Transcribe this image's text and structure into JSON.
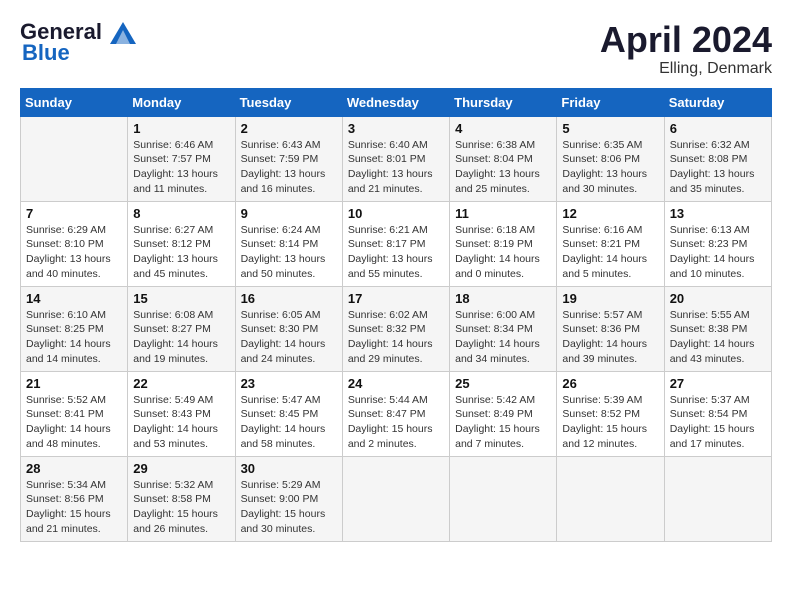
{
  "header": {
    "logo_line1": "General",
    "logo_line2": "Blue",
    "month_title": "April 2024",
    "location": "Elling, Denmark"
  },
  "days_of_week": [
    "Sunday",
    "Monday",
    "Tuesday",
    "Wednesday",
    "Thursday",
    "Friday",
    "Saturday"
  ],
  "weeks": [
    [
      {
        "num": "",
        "sunrise": "",
        "sunset": "",
        "daylight": ""
      },
      {
        "num": "1",
        "sunrise": "Sunrise: 6:46 AM",
        "sunset": "Sunset: 7:57 PM",
        "daylight": "Daylight: 13 hours and 11 minutes."
      },
      {
        "num": "2",
        "sunrise": "Sunrise: 6:43 AM",
        "sunset": "Sunset: 7:59 PM",
        "daylight": "Daylight: 13 hours and 16 minutes."
      },
      {
        "num": "3",
        "sunrise": "Sunrise: 6:40 AM",
        "sunset": "Sunset: 8:01 PM",
        "daylight": "Daylight: 13 hours and 21 minutes."
      },
      {
        "num": "4",
        "sunrise": "Sunrise: 6:38 AM",
        "sunset": "Sunset: 8:04 PM",
        "daylight": "Daylight: 13 hours and 25 minutes."
      },
      {
        "num": "5",
        "sunrise": "Sunrise: 6:35 AM",
        "sunset": "Sunset: 8:06 PM",
        "daylight": "Daylight: 13 hours and 30 minutes."
      },
      {
        "num": "6",
        "sunrise": "Sunrise: 6:32 AM",
        "sunset": "Sunset: 8:08 PM",
        "daylight": "Daylight: 13 hours and 35 minutes."
      }
    ],
    [
      {
        "num": "7",
        "sunrise": "Sunrise: 6:29 AM",
        "sunset": "Sunset: 8:10 PM",
        "daylight": "Daylight: 13 hours and 40 minutes."
      },
      {
        "num": "8",
        "sunrise": "Sunrise: 6:27 AM",
        "sunset": "Sunset: 8:12 PM",
        "daylight": "Daylight: 13 hours and 45 minutes."
      },
      {
        "num": "9",
        "sunrise": "Sunrise: 6:24 AM",
        "sunset": "Sunset: 8:14 PM",
        "daylight": "Daylight: 13 hours and 50 minutes."
      },
      {
        "num": "10",
        "sunrise": "Sunrise: 6:21 AM",
        "sunset": "Sunset: 8:17 PM",
        "daylight": "Daylight: 13 hours and 55 minutes."
      },
      {
        "num": "11",
        "sunrise": "Sunrise: 6:18 AM",
        "sunset": "Sunset: 8:19 PM",
        "daylight": "Daylight: 14 hours and 0 minutes."
      },
      {
        "num": "12",
        "sunrise": "Sunrise: 6:16 AM",
        "sunset": "Sunset: 8:21 PM",
        "daylight": "Daylight: 14 hours and 5 minutes."
      },
      {
        "num": "13",
        "sunrise": "Sunrise: 6:13 AM",
        "sunset": "Sunset: 8:23 PM",
        "daylight": "Daylight: 14 hours and 10 minutes."
      }
    ],
    [
      {
        "num": "14",
        "sunrise": "Sunrise: 6:10 AM",
        "sunset": "Sunset: 8:25 PM",
        "daylight": "Daylight: 14 hours and 14 minutes."
      },
      {
        "num": "15",
        "sunrise": "Sunrise: 6:08 AM",
        "sunset": "Sunset: 8:27 PM",
        "daylight": "Daylight: 14 hours and 19 minutes."
      },
      {
        "num": "16",
        "sunrise": "Sunrise: 6:05 AM",
        "sunset": "Sunset: 8:30 PM",
        "daylight": "Daylight: 14 hours and 24 minutes."
      },
      {
        "num": "17",
        "sunrise": "Sunrise: 6:02 AM",
        "sunset": "Sunset: 8:32 PM",
        "daylight": "Daylight: 14 hours and 29 minutes."
      },
      {
        "num": "18",
        "sunrise": "Sunrise: 6:00 AM",
        "sunset": "Sunset: 8:34 PM",
        "daylight": "Daylight: 14 hours and 34 minutes."
      },
      {
        "num": "19",
        "sunrise": "Sunrise: 5:57 AM",
        "sunset": "Sunset: 8:36 PM",
        "daylight": "Daylight: 14 hours and 39 minutes."
      },
      {
        "num": "20",
        "sunrise": "Sunrise: 5:55 AM",
        "sunset": "Sunset: 8:38 PM",
        "daylight": "Daylight: 14 hours and 43 minutes."
      }
    ],
    [
      {
        "num": "21",
        "sunrise": "Sunrise: 5:52 AM",
        "sunset": "Sunset: 8:41 PM",
        "daylight": "Daylight: 14 hours and 48 minutes."
      },
      {
        "num": "22",
        "sunrise": "Sunrise: 5:49 AM",
        "sunset": "Sunset: 8:43 PM",
        "daylight": "Daylight: 14 hours and 53 minutes."
      },
      {
        "num": "23",
        "sunrise": "Sunrise: 5:47 AM",
        "sunset": "Sunset: 8:45 PM",
        "daylight": "Daylight: 14 hours and 58 minutes."
      },
      {
        "num": "24",
        "sunrise": "Sunrise: 5:44 AM",
        "sunset": "Sunset: 8:47 PM",
        "daylight": "Daylight: 15 hours and 2 minutes."
      },
      {
        "num": "25",
        "sunrise": "Sunrise: 5:42 AM",
        "sunset": "Sunset: 8:49 PM",
        "daylight": "Daylight: 15 hours and 7 minutes."
      },
      {
        "num": "26",
        "sunrise": "Sunrise: 5:39 AM",
        "sunset": "Sunset: 8:52 PM",
        "daylight": "Daylight: 15 hours and 12 minutes."
      },
      {
        "num": "27",
        "sunrise": "Sunrise: 5:37 AM",
        "sunset": "Sunset: 8:54 PM",
        "daylight": "Daylight: 15 hours and 17 minutes."
      }
    ],
    [
      {
        "num": "28",
        "sunrise": "Sunrise: 5:34 AM",
        "sunset": "Sunset: 8:56 PM",
        "daylight": "Daylight: 15 hours and 21 minutes."
      },
      {
        "num": "29",
        "sunrise": "Sunrise: 5:32 AM",
        "sunset": "Sunset: 8:58 PM",
        "daylight": "Daylight: 15 hours and 26 minutes."
      },
      {
        "num": "30",
        "sunrise": "Sunrise: 5:29 AM",
        "sunset": "Sunset: 9:00 PM",
        "daylight": "Daylight: 15 hours and 30 minutes."
      },
      {
        "num": "",
        "sunrise": "",
        "sunset": "",
        "daylight": ""
      },
      {
        "num": "",
        "sunrise": "",
        "sunset": "",
        "daylight": ""
      },
      {
        "num": "",
        "sunrise": "",
        "sunset": "",
        "daylight": ""
      },
      {
        "num": "",
        "sunrise": "",
        "sunset": "",
        "daylight": ""
      }
    ]
  ]
}
